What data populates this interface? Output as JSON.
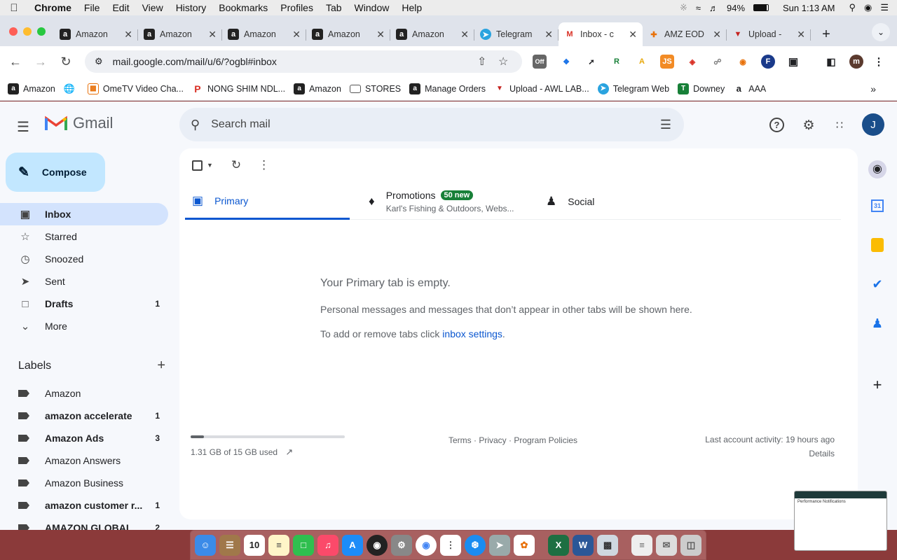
{
  "menubar": {
    "app": "Chrome",
    "items": [
      "File",
      "Edit",
      "View",
      "History",
      "Bookmarks",
      "Profiles",
      "Tab",
      "Window",
      "Help"
    ],
    "battery": "94%",
    "clock": "Sun 1:13 AM"
  },
  "tabs": [
    {
      "title": "Amazon",
      "icon": "amazon-icon"
    },
    {
      "title": "Amazon",
      "icon": "amazon-icon"
    },
    {
      "title": "Amazon",
      "icon": "amazon-icon"
    },
    {
      "title": "Amazon",
      "icon": "amazon-icon"
    },
    {
      "title": "Amazon",
      "icon": "amazon-icon"
    },
    {
      "title": "Telegram",
      "icon": "telegram-icon"
    },
    {
      "title": "Inbox - c",
      "icon": "gmail-icon"
    },
    {
      "title": "AMZ EOD",
      "icon": "amz-eod-icon"
    },
    {
      "title": "Upload -",
      "icon": "upload-icon"
    }
  ],
  "toolbar": {
    "url": "mail.google.com/mail/u/6/?ogbl#inbox",
    "ext_off_badge": "Off",
    "profile_initial": "m"
  },
  "bookmarks": [
    {
      "label": "Amazon"
    },
    {
      "label": ""
    },
    {
      "label": "OmeTV Video Cha..."
    },
    {
      "label": "NONG SHIM NDL..."
    },
    {
      "label": "Amazon"
    },
    {
      "label": "STORES"
    },
    {
      "label": "Manage Orders"
    },
    {
      "label": "Upload - AWL LAB..."
    },
    {
      "label": "Telegram Web"
    },
    {
      "label": "Downey"
    },
    {
      "label": "AAA"
    }
  ],
  "gmail": {
    "logo": "Gmail",
    "search_placeholder": "Search mail",
    "avatar": "J",
    "compose": "Compose",
    "nav": [
      {
        "label": "Inbox",
        "count": "",
        "selected": true
      },
      {
        "label": "Starred",
        "count": ""
      },
      {
        "label": "Snoozed",
        "count": ""
      },
      {
        "label": "Sent",
        "count": ""
      },
      {
        "label": "Drafts",
        "count": "1"
      },
      {
        "label": "More",
        "count": ""
      }
    ],
    "labels_title": "Labels",
    "labels": [
      {
        "label": "Amazon",
        "count": ""
      },
      {
        "label": "amazon accelerate",
        "count": "1"
      },
      {
        "label": "Amazon Ads",
        "count": "3"
      },
      {
        "label": "Amazon Answers",
        "count": ""
      },
      {
        "label": "Amazon Business",
        "count": ""
      },
      {
        "label": "amazon customer r...",
        "count": "1"
      },
      {
        "label": "AMAZON GLOBAL",
        "count": "2"
      }
    ],
    "inbox_tabs": {
      "primary": "Primary",
      "promotions": "Promotions",
      "promotions_badge": "50 new",
      "promotions_sub": "Karl's Fishing & Outdoors, Webs...",
      "social": "Social"
    },
    "empty": {
      "heading": "Your Primary tab is empty.",
      "body": "Personal messages and messages that don’t appear in other tabs will be shown here.",
      "settings_prefix": "To add or remove tabs click ",
      "settings_link": "inbox settings",
      "settings_suffix": "."
    },
    "footer": {
      "storage": "1.31 GB of 15 GB used",
      "storage_fraction": 0.087,
      "links": "Terms · Privacy · Program Policies",
      "activity": "Last account activity: 19 hours ago",
      "details": "Details"
    }
  },
  "thumbnail": {
    "title": "Performance Notifications"
  }
}
